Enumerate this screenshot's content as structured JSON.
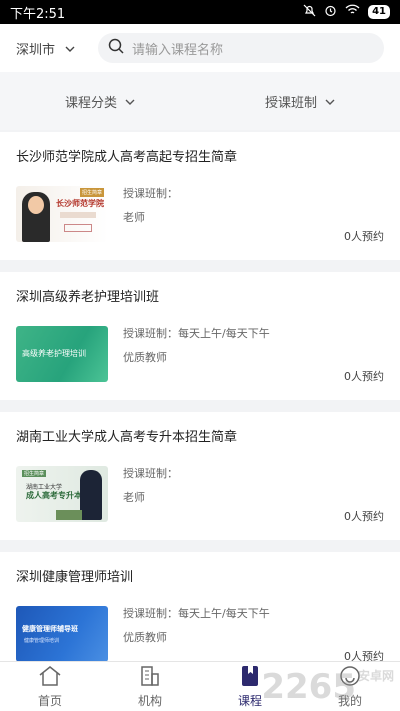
{
  "status_bar": {
    "time": "下午2:51",
    "battery": "41"
  },
  "search": {
    "city": "深圳市",
    "placeholder": "请输入课程名称"
  },
  "filters": [
    {
      "label": "课程分类"
    },
    {
      "label": "授课班制"
    }
  ],
  "courses": [
    {
      "title": "长沙师范学院成人高考高起专招生简章",
      "schedule": "授课班制：",
      "teacher": "老师",
      "count": "0人预约",
      "thumb": {
        "title": "长沙师范学院",
        "tag": "招生简章"
      }
    },
    {
      "title": "深圳高级养老护理培训班",
      "schedule": "授课班制：每天上午/每天下午",
      "teacher": "优质教师",
      "count": "0人预约",
      "thumb": {
        "title": "高级养老护理培训"
      }
    },
    {
      "title": "湖南工业大学成人高考专升本招生简章",
      "schedule": "授课班制：",
      "teacher": "老师",
      "count": "0人预约",
      "thumb": {
        "tag": "招生简章",
        "line1": "湖南工业大学",
        "line2": "成人高考专升本"
      }
    },
    {
      "title": "深圳健康管理师培训",
      "schedule": "授课班制：每天上午/每天下午",
      "teacher": "优质教师",
      "count": "0人预约",
      "thumb": {
        "title": "健康管理师辅导班",
        "sub": "健康管理师培训"
      }
    }
  ],
  "tabs": [
    {
      "label": "首页",
      "icon": "home-icon"
    },
    {
      "label": "机构",
      "icon": "building-icon"
    },
    {
      "label": "课程",
      "icon": "book-icon",
      "active": true
    },
    {
      "label": "我的",
      "icon": "user-icon"
    }
  ],
  "watermark": {
    "text": "2265",
    "suffix": "安卓网"
  },
  "colors": {
    "active_tab": "#2d2a6e",
    "background": "#f2f3f5"
  }
}
